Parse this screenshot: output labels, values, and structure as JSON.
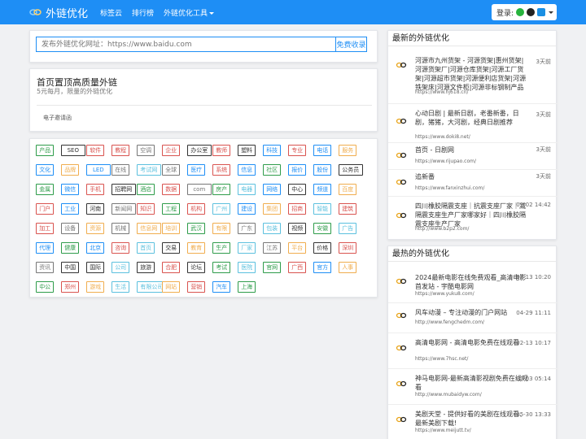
{
  "navbar": {
    "brand": "外链优化",
    "items": [
      "标签云",
      "排行榜",
      "外链优化工具"
    ],
    "login_label": "登录:"
  },
  "search": {
    "placeholder": "发布外链优化网址：https://www.baidu.com",
    "button": "免费收录"
  },
  "promo": {
    "title": "首页置顶高质量外链",
    "subtitle": "5元每月，限量的外链优化",
    "extra": "电子邀请函"
  },
  "tags": [
    [
      "产品",
      "#2e9c4a"
    ],
    [
      "SEO",
      "#333333"
    ],
    [
      "软件",
      "#d9534f"
    ],
    [
      "教程",
      "#d9534f"
    ],
    [
      "空调",
      "#777777"
    ],
    [
      "企业",
      "#d9534f"
    ],
    [
      "办公室",
      "#333333"
    ],
    [
      "教师",
      "#d9534f"
    ],
    [
      "塑料",
      "#333333"
    ],
    [
      "科技",
      "#1e8ef5"
    ],
    [
      "专业",
      "#d9534f"
    ],
    [
      "电话",
      "#1e8ef5"
    ],
    [
      "服务",
      "#f0ad4e"
    ],
    [
      "文化",
      "#1e8ef5"
    ],
    [
      "品牌",
      "#f0ad4e"
    ],
    [
      "LED",
      "#1e8ef5"
    ],
    [
      "在线",
      "#777777"
    ],
    [
      "考试网",
      "#5bc0de"
    ],
    [
      "全球",
      "#777777"
    ],
    [
      "医疗",
      "#1e8ef5"
    ],
    [
      "系统",
      "#d9534f"
    ],
    [
      "信息",
      "#1e8ef5"
    ],
    [
      "社区",
      "#2e9c4a"
    ],
    [
      "报价",
      "#1e8ef5"
    ],
    [
      "股份",
      "#1e8ef5"
    ],
    [
      "公务员",
      "#333333"
    ],
    [
      "金属",
      "#2e9c4a"
    ],
    [
      "微信",
      "#1e8ef5"
    ],
    [
      "手机",
      "#d9534f"
    ],
    [
      "招聘网",
      "#333333"
    ],
    [
      "酒店",
      "#2e9c4a"
    ],
    [
      "数据",
      "#d9534f"
    ],
    [
      "com",
      "#777777"
    ],
    [
      "房产",
      "#2e9c4a"
    ],
    [
      "电器",
      "#5bc0de"
    ],
    [
      "网络",
      "#1e8ef5"
    ],
    [
      "中心",
      "#333333"
    ],
    [
      "频道",
      "#1e8ef5"
    ],
    [
      "百度",
      "#f0ad4e"
    ],
    [
      "门户",
      "#d9534f"
    ],
    [
      "工业",
      "#1e8ef5"
    ],
    [
      "河南",
      "#333333"
    ],
    [
      "新闻网",
      "#777777"
    ],
    [
      "知识",
      "#d9534f"
    ],
    [
      "工程",
      "#2e9c4a"
    ],
    [
      "机构",
      "#d9534f"
    ],
    [
      "广州",
      "#5bc0de"
    ],
    [
      "建设",
      "#1e8ef5"
    ],
    [
      "集团",
      "#f0ad4e"
    ],
    [
      "招商",
      "#d9534f"
    ],
    [
      "智能",
      "#5bc0de"
    ],
    [
      "建筑",
      "#d9534f"
    ],
    [
      "加工",
      "#d9534f"
    ],
    [
      "设备",
      "#777777"
    ],
    [
      "资源",
      "#f0ad4e"
    ],
    [
      "机械",
      "#777777"
    ],
    [
      "信息网",
      "#f0ad4e"
    ],
    [
      "培训",
      "#f0ad4e"
    ],
    [
      "武汉",
      "#2e9c4a"
    ],
    [
      "有限",
      "#f0ad4e"
    ],
    [
      "广东",
      "#777777"
    ],
    [
      "包装",
      "#5bc0de"
    ],
    [
      "视频",
      "#333333"
    ],
    [
      "安徽",
      "#2e9c4a"
    ],
    [
      "广告",
      "#5bc0de"
    ],
    [
      "代理",
      "#1e8ef5"
    ],
    [
      "健康",
      "#2e9c4a"
    ],
    [
      "北京",
      "#1e8ef5"
    ],
    [
      "咨询",
      "#d9534f"
    ],
    [
      "首页",
      "#5bc0de"
    ],
    [
      "交易",
      "#333333"
    ],
    [
      "教育",
      "#f0ad4e"
    ],
    [
      "生产",
      "#2e9c4a"
    ],
    [
      "厂家",
      "#5bc0de"
    ],
    [
      "江苏",
      "#777777"
    ],
    [
      "平台",
      "#f0ad4e"
    ],
    [
      "价格",
      "#333333"
    ],
    [
      "深圳",
      "#d9534f"
    ],
    [
      "资讯",
      "#777777"
    ],
    [
      "中国",
      "#333333"
    ],
    [
      "国际",
      "#333333"
    ],
    [
      "公司",
      "#5bc0de"
    ],
    [
      "旅游",
      "#333333"
    ],
    [
      "合肥",
      "#d9534f"
    ],
    [
      "论坛",
      "#333333"
    ],
    [
      "考试",
      "#2e9c4a"
    ],
    [
      "医院",
      "#5bc0de"
    ],
    [
      "官网",
      "#2e9c4a"
    ],
    [
      "广西",
      "#d9534f"
    ],
    [
      "官方",
      "#1e8ef5"
    ],
    [
      "人事",
      "#f0ad4e"
    ],
    [
      "中公",
      "#2e9c4a"
    ],
    [
      "郑州",
      "#d9534f"
    ],
    [
      "游戏",
      "#f0ad4e"
    ],
    [
      "生活",
      "#5bc0de"
    ],
    [
      "有限公司",
      "#5bc0de"
    ],
    [
      "网站",
      "#f0ad4e"
    ],
    [
      "营销",
      "#d9534f"
    ],
    [
      "汽车",
      "#1e8ef5"
    ],
    [
      "上海",
      "#2e9c4a"
    ]
  ],
  "latest": {
    "title": "最新的外链优化",
    "items": [
      {
        "title": "河源市九州货架 - 河源货架|惠州货架|河源货架厂|河源仓库货架|河源工厂货架|河源超市货架|河源便利店货架|河源铁架床|河源文件柜|河源非标钢制产品",
        "url": "https://www.hj618.cn/",
        "time": "3天前"
      },
      {
        "title": "心动日剧 | 最新日剧，老番新番，日剧，猪猪，大河剧，经典日剧推荐",
        "url": "https://www.doki8.net/",
        "time": "3天前"
      },
      {
        "title": "首页 - 日剧网",
        "url": "https://www.rijupao.com/",
        "time": "3天前"
      },
      {
        "title": "追新番",
        "url": "https://www.fanxinzhui.com/",
        "time": "3天前"
      },
      {
        "title": "四川橡胶隔震支座｜抗震支座厂家｜减隔震支座生产厂家哪家好｜四川橡胶隔震支座生产厂家",
        "url": "http://www.b2p2.com/",
        "time": "09-02 14:42"
      }
    ]
  },
  "hottest": {
    "title": "最热的外链优化",
    "items": [
      {
        "title": "2024最新电影在线免费观看_高清电影首发站 - 宇酷电影网",
        "url": "https://www.yuku8.com/",
        "time": "02-13 10:20"
      },
      {
        "title": "风车动漫 – 专注动漫的门户网站",
        "url": "http://www.fengchedm.com/",
        "time": "04-29 11:11"
      },
      {
        "title": "高清电影网 - 高清电影免费在线观看",
        "url": "https://www.7hsc.net/",
        "time": "02-13 10:17"
      },
      {
        "title": "神马电影网-最新高清影视剧免费在线观看",
        "url": "http://www.mubaidyw.com/",
        "time": "07-03 05:14"
      },
      {
        "title": "美剧天堂 - 提供好看的美剧在线观看、最新美剧下载!",
        "url": "https://www.meijutt.tv/",
        "time": "05-30 13:33"
      }
    ]
  },
  "colors": {
    "accent": "#1e8ef5",
    "background": "#f0f1f3"
  }
}
